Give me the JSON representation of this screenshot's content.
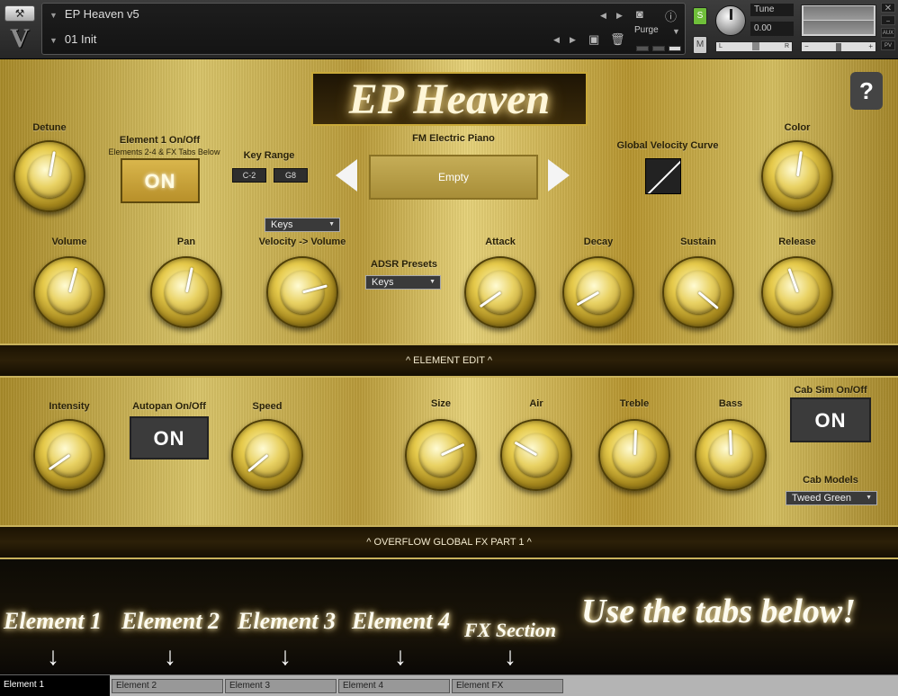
{
  "header": {
    "instrument_name": "EP Heaven v5",
    "snapshot_name": "01 Init",
    "purge_label": "Purge",
    "solo_label": "S",
    "mute_label": "M",
    "tune_label": "Tune",
    "tune_value": "0.00",
    "pan_left": "L",
    "pan_right": "R",
    "aux_label": "AUX",
    "pv_label": "PV"
  },
  "logo": "EP Heaven",
  "help_label": "?",
  "element_edit": {
    "detune": "Detune",
    "element_onoff": "Element 1 On/Off",
    "element_onoff_sub": "Elements 2-4 & FX Tabs Below",
    "element_on_button": "ON",
    "key_range": "Key Range",
    "key_low": "C-2",
    "key_high": "G8",
    "sample_title": "FM Electric Piano",
    "sample_value": "Empty",
    "global_velocity_curve": "Global Velocity Curve",
    "color": "Color",
    "vel_dropdown": "Keys",
    "volume": "Volume",
    "pan": "Pan",
    "velocity_volume": "Velocity -> Volume",
    "adsr_presets": "ADSR Presets",
    "adsr_dropdown": "Keys",
    "attack": "Attack",
    "decay": "Decay",
    "sustain": "Sustain",
    "release": "Release",
    "section_bar": "^ ELEMENT EDIT ^"
  },
  "global_fx": {
    "intensity": "Intensity",
    "autopan": "Autopan On/Off",
    "autopan_button": "ON",
    "speed": "Speed",
    "size": "Size",
    "air": "Air",
    "treble": "Treble",
    "bass": "Bass",
    "cab_sim": "Cab Sim On/Off",
    "cab_button": "ON",
    "cab_models": "Cab Models",
    "cab_dropdown": "Tweed Green",
    "section_bar": "^ OVERFLOW GLOBAL FX PART 1 ^"
  },
  "bottom": {
    "element1": "Element 1",
    "element2": "Element 2",
    "element3": "Element 3",
    "element4": "Element 4",
    "fx_section": "FX Section",
    "tagline": "Use the tabs below!",
    "arrow": "↓"
  },
  "tabs": [
    "Element 1",
    "Element 2",
    "Element 3",
    "Element 4",
    "Element FX"
  ],
  "knob_angles_deg": {
    "detune": 10,
    "color": 8,
    "volume": 15,
    "pan": 12,
    "velocity_volume": 75,
    "attack": -125,
    "decay": -120,
    "sustain": 130,
    "release": -20,
    "intensity": -125,
    "speed": -130,
    "size": 65,
    "air": -60,
    "treble": 2,
    "bass": -2
  }
}
